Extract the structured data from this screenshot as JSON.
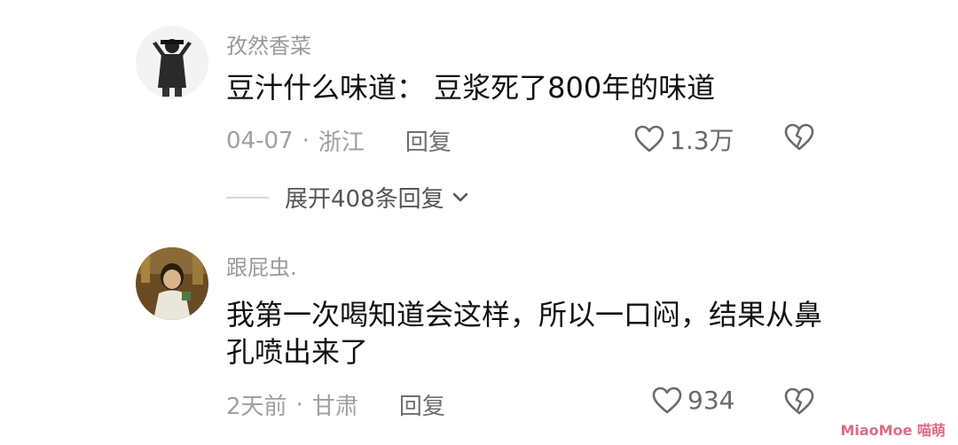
{
  "comments": [
    {
      "username": "孜然香菜",
      "content": "豆汁什么味道： 豆浆死了800年的味道",
      "date": "04-07",
      "separator": "·",
      "location": "浙江",
      "reply_label": "回复",
      "like_count": "1.3万",
      "icons": {
        "like": "heart-outline-icon",
        "dislike": "broken-heart-icon"
      }
    },
    {
      "username": "跟屁虫.",
      "content": "我第一次喝知道会这样，所以一口闷，结果从鼻孔喷出来了",
      "date": "2天前",
      "separator": "·",
      "location": "甘肃",
      "reply_label": "回复",
      "like_count": "934",
      "icons": {
        "like": "heart-outline-icon",
        "dislike": "broken-heart-icon"
      }
    }
  ],
  "expand_replies": {
    "label": "展开408条回复",
    "icon": "chevron-down-icon"
  },
  "watermark": "MiaoMoe 喵萌",
  "colors": {
    "username": "#9a9a9a",
    "content": "#111111",
    "meta": "#a0a0a0",
    "icon": "#6a6a6a"
  }
}
